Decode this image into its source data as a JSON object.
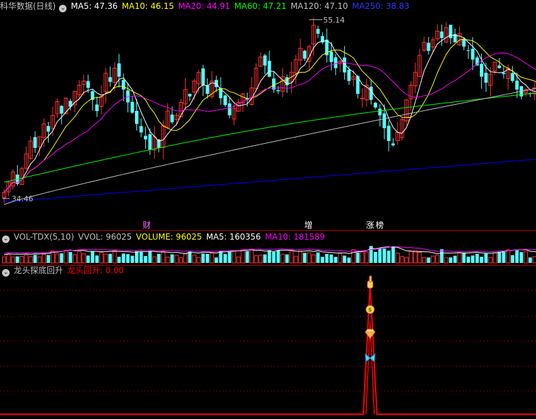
{
  "colors": {
    "ma5": "#ffffff",
    "ma10": "#ffff00",
    "ma20": "#ff00ff",
    "ma60": "#00ff00",
    "ma120": "#c0c0c0",
    "ma250": "#0000ff",
    "up": "#ff3232",
    "down": "#54ffff",
    "signal": "#ff0000"
  },
  "main": {
    "title": "科华数据(日线)",
    "legend": [
      {
        "text": "MA5: 47.36",
        "color": "#ffffff"
      },
      {
        "text": "MA10: 46.15",
        "color": "#ffff00"
      },
      {
        "text": "MA20: 44.91",
        "color": "#ff00ff"
      },
      {
        "text": "MA60: 47.21",
        "color": "#00ff00"
      },
      {
        "text": "MA120: 47.10",
        "color": "#c0c0c0"
      },
      {
        "text": "MA250: 38.83",
        "color": "#3333ff"
      }
    ],
    "high_label": "55.14",
    "low_label": "34.46",
    "markers": [
      {
        "text": "财",
        "color": "#ff66ff"
      },
      {
        "text": "增",
        "color": "#ffffff"
      },
      {
        "text": "涨",
        "color": "#ffffff"
      },
      {
        "text": "榜",
        "color": "#ffffff"
      }
    ]
  },
  "volume": {
    "legend": [
      {
        "text": "VOL-TDX(5,10)",
        "color": "#c0c0c0"
      },
      {
        "text": "VVOL: 96025",
        "color": "#c0c0c0"
      },
      {
        "text": "VOLUME: 96025",
        "color": "#ffff00"
      },
      {
        "text": "MA5: 160356",
        "color": "#ffffff"
      },
      {
        "text": "MA10: 181589",
        "color": "#ff00ff"
      }
    ]
  },
  "indicator": {
    "title": "龙头探底回升",
    "legend": [
      {
        "text": "龙头回升: 0.00",
        "color": "#ff0000"
      }
    ],
    "icons": [
      "pointing-hand-icon",
      "money-bag-icon",
      "diamond-icon",
      "butterfly-icon"
    ]
  },
  "chart_data": [
    {
      "type": "candlestick",
      "title": "科华数据(日线)",
      "price_range": [
        33.5,
        56.0
      ],
      "high": 55.14,
      "low": 34.46,
      "series": [
        {
          "name": "MA5",
          "last": 47.36
        },
        {
          "name": "MA10",
          "last": 46.15
        },
        {
          "name": "MA20",
          "last": 44.91
        },
        {
          "name": "MA60",
          "last": 47.21
        },
        {
          "name": "MA120",
          "last": 47.1
        },
        {
          "name": "MA250",
          "last": 38.83
        }
      ],
      "close": [
        35.0,
        36.2,
        37.4,
        36.0,
        37.8,
        39.5,
        41.0,
        40.2,
        41.5,
        43.0,
        42.1,
        44.0,
        45.6,
        44.2,
        46.0,
        45.0,
        46.8,
        47.5,
        48.0,
        47.2,
        45.8,
        44.5,
        46.2,
        48.9,
        47.9,
        49.5,
        48.5,
        47.0,
        45.5,
        44.3,
        43.0,
        42.0,
        41.2,
        40.0,
        41.5,
        40.2,
        42.8,
        44.5,
        43.2,
        44.0,
        45.5,
        47.0,
        46.2,
        48.0,
        49.0,
        47.5,
        46.5,
        48.0,
        47.3,
        46.0,
        45.2,
        44.0,
        44.8,
        45.5,
        46.5,
        45.8,
        47.2,
        49.5,
        50.8,
        49.8,
        48.5,
        47.0,
        46.8,
        48.5,
        47.5,
        49.0,
        50.5,
        51.8,
        50.6,
        52.0,
        54.5,
        53.5,
        52.5,
        51.0,
        50.2,
        49.5,
        50.3,
        49.0,
        48.0,
        48.5,
        46.5,
        46.0,
        47.5,
        45.8,
        44.9,
        44.0,
        42.5,
        41.0,
        40.5,
        42.0,
        43.5,
        45.8,
        47.5,
        49.0,
        51.0,
        52.5,
        51.5,
        52.8,
        53.8,
        53.0,
        54.2,
        53.0,
        52.5,
        53.5,
        52.0,
        51.5,
        50.5,
        49.8,
        48.5,
        47.8,
        48.8,
        50.2,
        49.5,
        48.8,
        49.5,
        48.0,
        47.0,
        46.2,
        47.0,
        46.5,
        47.2,
        46.8
      ]
    },
    {
      "type": "bar",
      "title": "VOL-TDX(5,10)",
      "series": [
        {
          "name": "VOLUME",
          "last": 96025
        },
        {
          "name": "MA5",
          "last": 160356
        },
        {
          "name": "MA10",
          "last": 181589
        }
      ]
    },
    {
      "type": "line",
      "title": "龙头探底回升",
      "series": [
        {
          "name": "龙头回升",
          "last": 0.0
        }
      ]
    }
  ]
}
